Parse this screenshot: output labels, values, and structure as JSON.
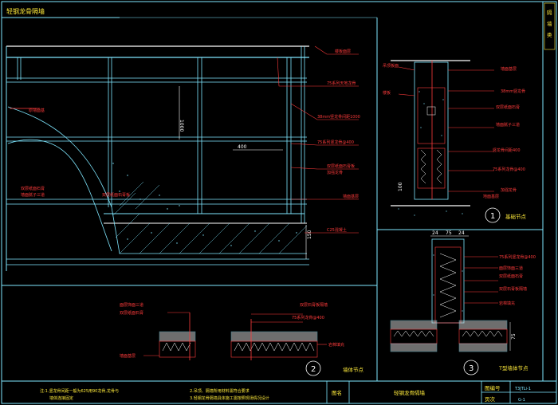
{
  "title": "轻钢龙骨隔墙",
  "side_tab": "隔墙类",
  "main_labels": {
    "floor_top": "楼板面层",
    "stud": "75系列天地龙骨",
    "rail": "38mm竖龙骨间距1000",
    "keel": "75系列竖龙骨@400",
    "board": "双层纸面石膏板",
    "board2": "加强龙骨",
    "wall": "墙面基层",
    "c25": "C25混凝土",
    "left_a": "原墙面基",
    "left_b": "双层纸面石膏",
    "left_c": "墙面腻子三道",
    "dim_900": "1000",
    "dim_400": "400",
    "dim_150": "150"
  },
  "node1_labels": {
    "a": "吊顶板面",
    "b": "楼板",
    "c": "墙面基层",
    "d": "38mm竖龙骨",
    "e": "双层纸面石膏",
    "f": "墙面腻子三道",
    "g": "竖龙骨间距400",
    "h": "75系列龙骨@400",
    "i": "加强龙骨",
    "j": "地面基层",
    "dim": "100",
    "caption": "基础节点",
    "num": "1"
  },
  "node2_labels": {
    "a": "面层饰面三道",
    "b": "双层纸面石膏",
    "c": "双层石膏板隔墙",
    "d": "75系列龙骨@400",
    "e": "岩棉填充",
    "f": "墙面基层",
    "caption": "墙体节点",
    "num": "2"
  },
  "node3_labels": {
    "dims": [
      "24",
      "75",
      "24"
    ],
    "a": "75系列竖龙骨@400",
    "b": "面层饰面三道",
    "c": "双层纸面石膏",
    "d": "双层石膏板隔墙",
    "e": "岩棉填充",
    "dim": "75",
    "caption": "T型墙体节点",
    "num": "3"
  },
  "notes": {
    "n1": "注:1.竖龙骨间距一般为625用90龙骨,龙骨与",
    "n1b": "墙体连接固定",
    "n2": "2.吊顶、隔墙所用材料需符合要求",
    "n3": "3.轻钢龙骨隔墙具体施工需按照现场情况设计"
  },
  "title_block": {
    "name_label": "图名",
    "name_value": "轻钢龙骨隔墙",
    "code_label": "图编号",
    "code_value": "T3JTLi-1",
    "page_label": "页次",
    "page_value": "G-1"
  }
}
